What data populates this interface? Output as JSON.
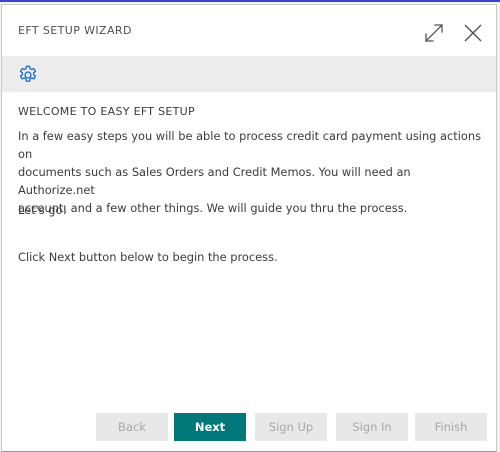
{
  "window": {
    "title": "EFT SETUP WIZARD",
    "icons": {
      "expand": "expand-icon",
      "close": "close-icon",
      "settings": "gear-icon"
    },
    "accent_color": "#00787a"
  },
  "content": {
    "heading": "WELCOME TO EASY EFT SETUP",
    "paragraph1_line1": "In a few easy steps you will be able to process credit card payment using actions on",
    "paragraph1_line2": "documents such as Sales Orders and Credit Memos. You will need an Authorize.net",
    "paragraph1_line3": "account, and a few other things. We will guide you thru the process.",
    "paragraph2": "Let's go!",
    "paragraph3": "Click Next button below to begin the process."
  },
  "footer": {
    "back_label": "Back",
    "next_label": "Next",
    "signup_label": "Sign Up",
    "signin_label": "Sign In",
    "finish_label": "Finish"
  }
}
